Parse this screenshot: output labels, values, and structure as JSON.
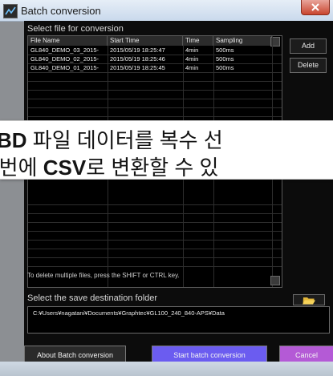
{
  "window": {
    "title": "Batch conversion"
  },
  "file_section": {
    "label": "Select file for conversion",
    "columns": [
      "File Name",
      "Start Time",
      "Time",
      "Sampling"
    ],
    "rows": [
      [
        "GL840_DEMO_03_2015-",
        "2015/05/19 18:25:47",
        "4min",
        "500ms"
      ],
      [
        "GL840_DEMO_02_2015-",
        "2015/05/19 18:25:46",
        "4min",
        "500ms"
      ],
      [
        "GL840_DEMO_01_2015-",
        "2015/05/19 18:25:45",
        "4min",
        "500ms"
      ]
    ],
    "add_label": "Add",
    "delete_label": "Delete",
    "hint": "To delete multiple files, press the SHIFT or CTRL key."
  },
  "overlay": {
    "line1_prefix": "",
    "line1_bold": "BD",
    "line1_rest": " 파일 데이터를 복수 선",
    "line2_prefix": "·번에 ",
    "line2_bold": "CSV",
    "line2_rest": "로 변환할 수 있"
  },
  "save_section": {
    "label": "Select the save destination folder",
    "path": "C:¥Users¥nagatani¥Documents¥Graphtec¥GL100_240_840-APS¥Data"
  },
  "buttons": {
    "about": "About Batch conversion",
    "start": "Start batch conversion",
    "cancel": "Cancel"
  },
  "colors": {
    "panel": "#0c0c0c",
    "start_button": "#6b5cf0",
    "cancel_button": "#b45ad6"
  },
  "icons": {
    "folder": "folder-open-icon",
    "app": "app-icon"
  }
}
